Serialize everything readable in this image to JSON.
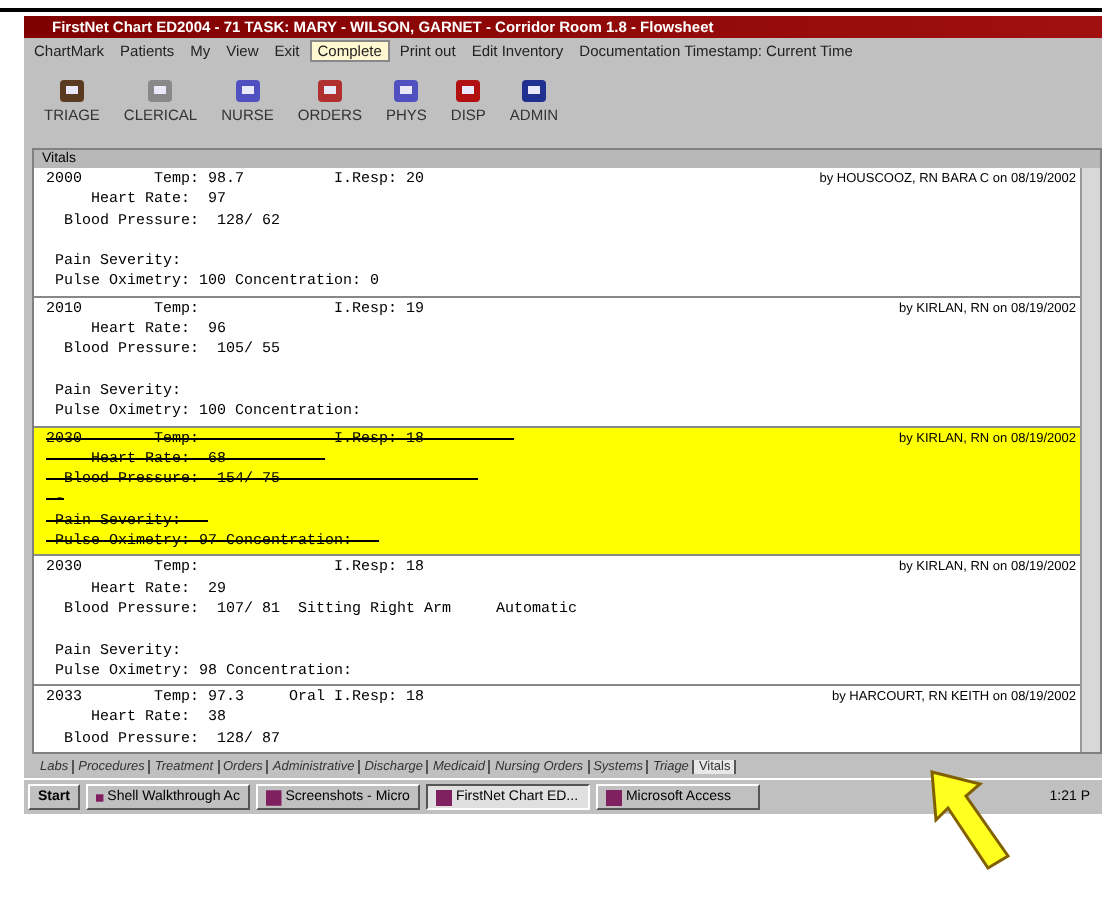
{
  "window": {
    "title": "FirstNet Chart ED2004 - 71 TASK: MARY - WILSON, GARNET - Corridor Room 1.8 - Flowsheet"
  },
  "menu": [
    {
      "label": "ChartMark",
      "selected": false
    },
    {
      "label": "Patients",
      "selected": false
    },
    {
      "label": "My",
      "selected": false
    },
    {
      "label": "View",
      "selected": false
    },
    {
      "label": "Exit",
      "selected": false
    },
    {
      "label": "Complete",
      "selected": true
    },
    {
      "label": "Print out",
      "selected": false
    },
    {
      "label": "Edit Inventory",
      "selected": false
    },
    {
      "label": "Documentation Timestamp: Current Time",
      "selected": false
    }
  ],
  "toolbar": [
    "TRIAGE",
    "CLERICAL",
    "NURSE",
    "ORDERS",
    "PHYS",
    "DISP",
    "ADMIN"
  ],
  "panel": {
    "title": "Vitals",
    "entries": [
      {
        "struck": false,
        "signature": "by HOUSCOOZ, RN BARA C on 08/19/2002",
        "lines": [
          "2000        Temp: 98.7          I.Resp: 20",
          "     Heart Rate:  97",
          "  Blood Pressure:  128/ 62"
        ],
        "notes": [
          " Pain Severity:",
          " Pulse Oximetry: 100 Concentration: 0"
        ]
      },
      {
        "struck": false,
        "signature": "by KIRLAN, RN on 08/19/2002",
        "lines": [
          "2010        Temp:               I.Resp: 19",
          "     Heart Rate:  96",
          "  Blood Pressure:  105/ 55"
        ],
        "notes": [
          " Pain Severity:",
          " Pulse Oximetry: 100 Concentration:"
        ]
      },
      {
        "struck": true,
        "signature": "by KIRLAN, RN on 08/19/2002",
        "lines": [
          "2030        Temp:               I.Resp: 18          ",
          "     Heart Rate:  68           ",
          "  Blood Pressure:  154/ 75                      ",
          " -"
        ],
        "notes": [
          " Pain Severity:   ",
          " Pulse Oximetry: 97 Concentration:   "
        ]
      },
      {
        "struck": false,
        "signature": "by KIRLAN, RN on 08/19/2002",
        "lines": [
          "2030        Temp:               I.Resp: 18",
          "     Heart Rate:  29",
          "  Blood Pressure:  107/ 81  Sitting Right Arm     Automatic"
        ],
        "notes": [
          " Pain Severity:",
          " Pulse Oximetry: 98 Concentration:"
        ]
      },
      {
        "struck": false,
        "signature": "by HARCOURT, RN KEITH on 08/19/2002",
        "lines": [
          "2033        Temp: 97.3     Oral I.Resp: 18",
          "     Heart Rate:  38",
          "  Blood Pressure:  128/ 87"
        ]
      }
    ]
  },
  "tabs": [
    {
      "label": "Labs",
      "selected": false
    },
    {
      "label": "Procedures",
      "selected": false
    },
    {
      "label": "Treatment",
      "selected": false
    },
    {
      "label": "Orders",
      "selected": false
    },
    {
      "label": "Administrative",
      "selected": false
    },
    {
      "label": "Discharge",
      "selected": false
    },
    {
      "label": "Medicaid",
      "selected": false
    },
    {
      "label": "Nursing Orders",
      "selected": false
    },
    {
      "label": "Systems",
      "selected": false
    },
    {
      "label": "Triage",
      "selected": false
    },
    {
      "label": "Vitals",
      "selected": true
    }
  ],
  "taskbar": {
    "start": "Start",
    "items": [
      {
        "label": "Shell Walkthrough Ac",
        "selected": false
      },
      {
        "label": "Screenshots - Micro",
        "selected": false
      },
      {
        "label": "FirstNet Chart ED...",
        "selected": true
      },
      {
        "label": "Microsoft Access",
        "selected": false
      }
    ],
    "clock": "1:21 P"
  }
}
